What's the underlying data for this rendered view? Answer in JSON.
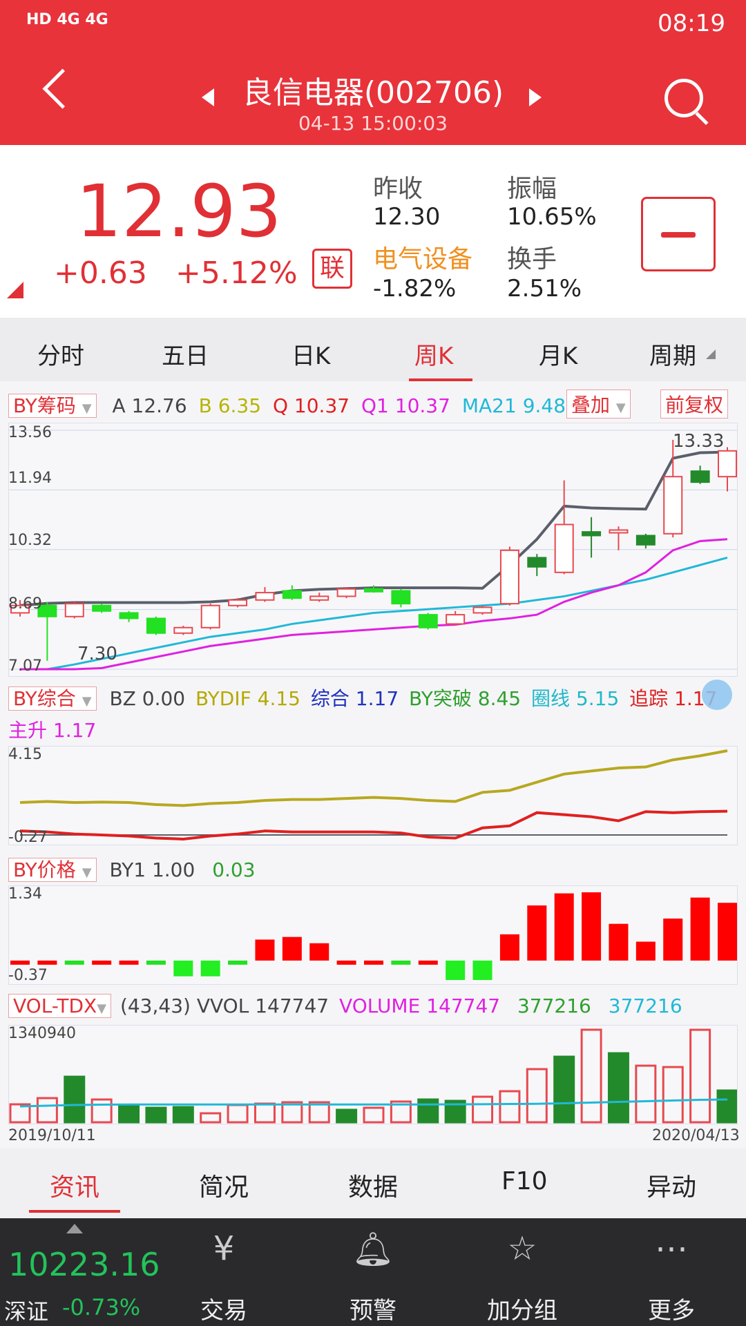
{
  "status": {
    "left": "HD 4G 4G",
    "time": "08:19"
  },
  "header": {
    "title": "良信电器(002706)",
    "subtitle": "04-13 15:00:03"
  },
  "quote": {
    "price": "12.93",
    "change": "+0.63",
    "change_pct": "+5.12%",
    "badge": "联",
    "prev_close_label": "昨收",
    "prev_close": "12.30",
    "amplitude_label": "振幅",
    "amplitude": "10.65%",
    "sector_label": "电气设备",
    "sector_chg": "-1.82%",
    "turnover_label": "换手",
    "turnover": "2.51%"
  },
  "tabs": [
    "分时",
    "五日",
    "日K",
    "周K",
    "月K",
    "周期"
  ],
  "active_tab": "周K",
  "indicators": {
    "main": {
      "dropdown": "BY筹码",
      "A_label": "A",
      "A": "12.76",
      "B_label": "B",
      "B": "6.35",
      "Q_label": "Q",
      "Q": "10.37",
      "Q1_label": "Q1",
      "Q1": "10.37",
      "MA21_label": "MA21",
      "MA21": "9.48",
      "overlay": "叠加",
      "adjust": "前复权"
    },
    "comp": {
      "dropdown": "BY综合",
      "BZ_label": "BZ",
      "BZ": "0.00",
      "BYDIF_label": "BYDIF",
      "BYDIF": "4.15",
      "zonghe_label": "综合",
      "zonghe": "1.17",
      "tupo_label": "BY突破",
      "tupo": "8.45",
      "quan_label": "圈线",
      "quan": "5.15",
      "zhui_label": "追踪",
      "zhui": "1.17",
      "zhu_label": "主升",
      "zhu": "1.17"
    },
    "price": {
      "dropdown": "BY价格",
      "BY1_label": "BY1",
      "BY1": "1.00",
      "v2": "0.03"
    },
    "vol": {
      "dropdown": "VOL-TDX",
      "params": "(43,43)",
      "VVOL_label": "VVOL",
      "VVOL": "147747",
      "VOLUME_label": "VOLUME",
      "VOLUME": "147747",
      "v3": "377216",
      "v4": "377216"
    }
  },
  "chart_data": [
    {
      "type": "candlestick",
      "title": "",
      "y_ticks": [
        "13.56",
        "11.94",
        "10.32",
        "8.69",
        "7.07"
      ],
      "ylim": [
        7.07,
        13.56
      ],
      "annotations": [
        "7.30",
        "13.33"
      ],
      "x_start": "2019/10/11",
      "x_end": "2020/04/13",
      "candles": [
        {
          "o": 8.6,
          "c": 8.8,
          "h": 8.95,
          "l": 8.5
        },
        {
          "o": 8.8,
          "c": 8.5,
          "h": 8.9,
          "l": 7.3
        },
        {
          "o": 8.5,
          "c": 8.85,
          "h": 8.9,
          "l": 8.45
        },
        {
          "o": 8.8,
          "c": 8.65,
          "h": 8.85,
          "l": 8.6
        },
        {
          "o": 8.6,
          "c": 8.45,
          "h": 8.65,
          "l": 8.35
        },
        {
          "o": 8.45,
          "c": 8.05,
          "h": 8.5,
          "l": 8.0
        },
        {
          "o": 8.05,
          "c": 8.2,
          "h": 8.25,
          "l": 8.0
        },
        {
          "o": 8.2,
          "c": 8.8,
          "h": 8.85,
          "l": 8.15
        },
        {
          "o": 8.8,
          "c": 8.95,
          "h": 9.0,
          "l": 8.75
        },
        {
          "o": 8.95,
          "c": 9.15,
          "h": 9.3,
          "l": 8.9
        },
        {
          "o": 9.2,
          "c": 9.0,
          "h": 9.35,
          "l": 8.95
        },
        {
          "o": 8.95,
          "c": 9.05,
          "h": 9.15,
          "l": 8.9
        },
        {
          "o": 9.05,
          "c": 9.25,
          "h": 9.3,
          "l": 9.0
        },
        {
          "o": 9.25,
          "c": 9.2,
          "h": 9.35,
          "l": 9.15
        },
        {
          "o": 9.2,
          "c": 8.85,
          "h": 9.25,
          "l": 8.75
        },
        {
          "o": 8.55,
          "c": 8.2,
          "h": 8.6,
          "l": 8.15
        },
        {
          "o": 8.3,
          "c": 8.55,
          "h": 8.65,
          "l": 8.25
        },
        {
          "o": 8.6,
          "c": 8.75,
          "h": 8.8,
          "l": 8.55
        },
        {
          "o": 8.85,
          "c": 10.3,
          "h": 10.4,
          "l": 8.8
        },
        {
          "o": 10.1,
          "c": 9.85,
          "h": 10.2,
          "l": 9.6
        },
        {
          "o": 9.7,
          "c": 11.0,
          "h": 12.2,
          "l": 9.65
        },
        {
          "o": 10.8,
          "c": 10.7,
          "h": 11.2,
          "l": 10.1
        },
        {
          "o": 10.8,
          "c": 10.85,
          "h": 10.95,
          "l": 10.3
        },
        {
          "o": 10.7,
          "c": 10.45,
          "h": 10.75,
          "l": 10.35
        },
        {
          "o": 10.75,
          "c": 12.3,
          "h": 13.3,
          "l": 10.65
        },
        {
          "o": 12.45,
          "c": 12.15,
          "h": 12.6,
          "l": 12.1
        },
        {
          "o": 12.3,
          "c": 13.0,
          "h": 13.1,
          "l": 11.9
        }
      ],
      "series": [
        {
          "values": [
            8.8,
            8.86,
            8.88,
            8.88,
            8.88,
            8.88,
            8.88,
            8.9,
            8.95,
            9.1,
            9.2,
            9.24,
            9.26,
            9.28,
            9.28,
            9.28,
            9.28,
            9.27,
            9.9,
            10.6,
            11.5,
            11.45,
            11.43,
            11.42,
            12.8,
            12.95,
            12.97
          ]
        },
        {
          "values": [
            6.9,
            7.05,
            7.2,
            7.35,
            7.5,
            7.65,
            7.8,
            7.95,
            8.05,
            8.15,
            8.3,
            8.4,
            8.5,
            8.6,
            8.65,
            8.7,
            8.75,
            8.8,
            8.85,
            8.95,
            9.05,
            9.2,
            9.35,
            9.5,
            9.7,
            9.9,
            10.1
          ]
        },
        {
          "values": [
            6.8,
            6.9,
            7.0,
            7.1,
            7.25,
            7.4,
            7.55,
            7.7,
            7.8,
            7.9,
            8.0,
            8.05,
            8.1,
            8.15,
            8.2,
            8.25,
            8.28,
            8.38,
            8.45,
            8.55,
            8.9,
            9.15,
            9.35,
            9.7,
            10.3,
            10.55,
            10.6
          ]
        }
      ]
    },
    {
      "type": "line",
      "y_ticks": [
        "4.15",
        "-0.27"
      ],
      "ylim": [
        -0.27,
        4.15
      ],
      "series": [
        {
          "values": [
            1.6,
            1.65,
            1.6,
            1.62,
            1.6,
            1.5,
            1.45,
            1.55,
            1.6,
            1.7,
            1.75,
            1.75,
            1.8,
            1.85,
            1.8,
            1.7,
            1.65,
            2.1,
            2.2,
            2.6,
            3.0,
            3.15,
            3.3,
            3.35,
            3.7,
            3.9,
            4.15
          ]
        },
        {
          "values": [
            0.2,
            0.15,
            0.05,
            0.0,
            -0.05,
            -0.15,
            -0.2,
            -0.05,
            0.05,
            0.2,
            0.15,
            0.15,
            0.15,
            0.15,
            0.1,
            -0.1,
            -0.15,
            0.35,
            0.45,
            1.1,
            1.0,
            0.9,
            0.7,
            1.15,
            1.1,
            1.15,
            1.17
          ]
        },
        {
          "values": [
            0,
            0,
            0,
            0,
            0,
            0,
            0,
            0,
            0,
            0,
            0,
            0,
            0,
            0,
            0,
            0,
            0,
            0,
            0,
            0,
            0,
            0,
            0,
            0,
            0,
            0,
            0
          ]
        }
      ]
    },
    {
      "type": "bar",
      "y_ticks": [
        "1.34",
        "-0.37"
      ],
      "ylim": [
        -0.37,
        1.34
      ],
      "values": [
        -0.05,
        -0.05,
        -0.06,
        -0.05,
        -0.05,
        -0.07,
        -0.3,
        -0.3,
        -0.05,
        0.4,
        0.45,
        0.33,
        -0.05,
        -0.05,
        -0.05,
        -0.06,
        -0.37,
        -0.37,
        0.5,
        1.05,
        1.28,
        1.3,
        0.7,
        0.36,
        0.8,
        1.2,
        1.1
      ]
    },
    {
      "type": "bar",
      "y_ticks": [
        "1340940"
      ],
      "x_ticks": [
        "2019/10/11",
        "2020/04/13"
      ],
      "values": [
        260000,
        350000,
        660000,
        330000,
        250000,
        210000,
        220000,
        130000,
        250000,
        270000,
        290000,
        290000,
        180000,
        210000,
        300000,
        330000,
        310000,
        370000,
        450000,
        770000,
        950000,
        1340940,
        1000000,
        820000,
        800000,
        1340000,
        460000
      ],
      "up": [
        true,
        true,
        false,
        true,
        false,
        false,
        false,
        true,
        true,
        true,
        true,
        true,
        false,
        true,
        true,
        false,
        false,
        true,
        true,
        true,
        false,
        true,
        false,
        true,
        true,
        true,
        false
      ],
      "ma": [
        230000,
        240000,
        250000,
        255000,
        258000,
        258000,
        258000,
        258000,
        258000,
        258000,
        258000,
        258000,
        258000,
        258000,
        258000,
        258000,
        260000,
        262000,
        265000,
        268000,
        275000,
        285000,
        295000,
        305000,
        315000,
        325000,
        330000
      ]
    }
  ],
  "bottom_tabs": [
    "资讯",
    "简况",
    "数据",
    "F10",
    "异动"
  ],
  "footer": {
    "index_value": "10223.16",
    "index_name": "深证",
    "index_pct": "-0.73%",
    "buttons": [
      "交易",
      "预警",
      "加分组",
      "更多"
    ]
  }
}
